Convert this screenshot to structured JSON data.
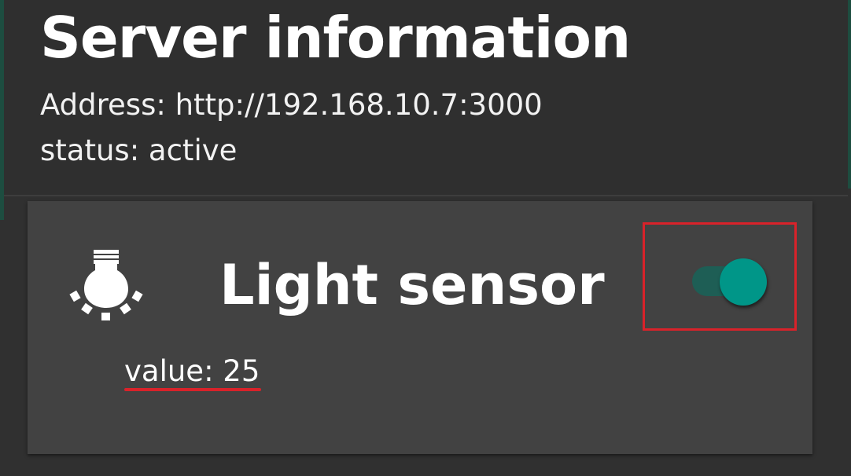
{
  "header": {
    "title": "Server information",
    "address": "Address: http://192.168.10.7:3000",
    "status": "status: active"
  },
  "sensor_card": {
    "icon": "light-bulb-icon",
    "title": "Light sensor",
    "toggle_on": true,
    "value_text": "value: 25"
  },
  "colors": {
    "background": "#303030",
    "card": "#424242",
    "accent": "#009688",
    "highlight": "#d9222a"
  }
}
